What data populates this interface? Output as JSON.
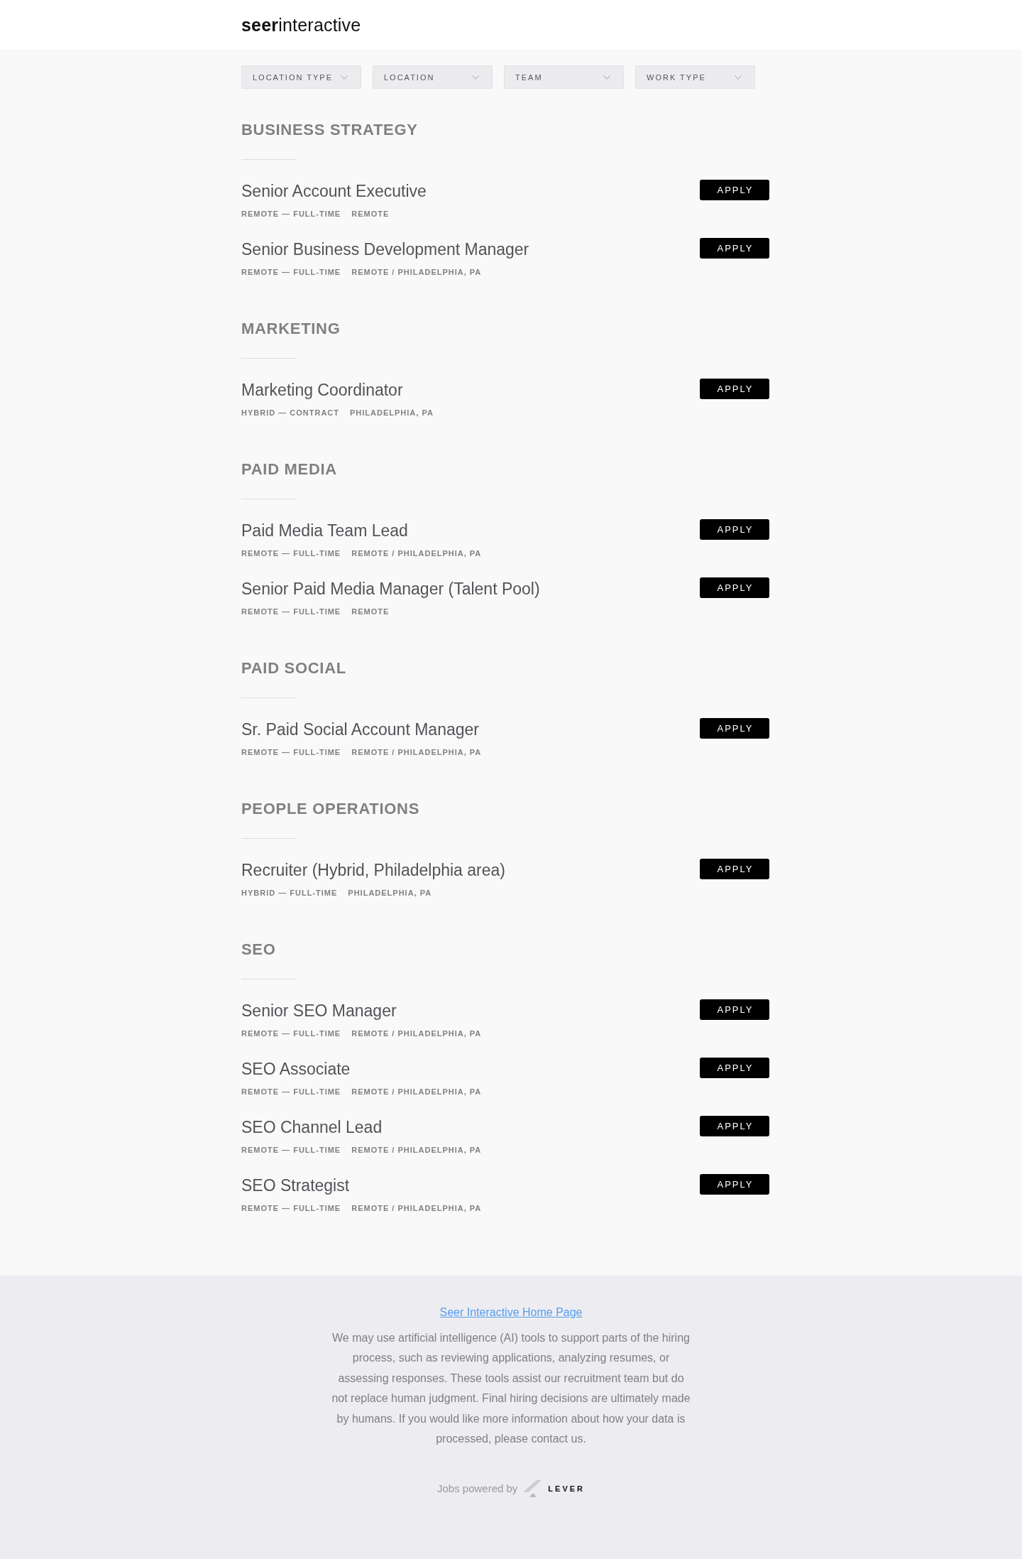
{
  "header": {
    "logo": "**seer**interactive"
  },
  "filters": [
    {
      "label": "LOCATION TYPE"
    },
    {
      "label": "LOCATION"
    },
    {
      "label": "TEAM"
    },
    {
      "label": "WORK TYPE"
    }
  ],
  "sections": [
    {
      "title": "BUSINESS STRATEGY",
      "postings": [
        {
          "title": "Senior Account Executive",
          "work_type": "REMOTE — FULL-TIME",
          "location": "REMOTE",
          "button": "APPLY"
        },
        {
          "title": "Senior Business Development Manager",
          "work_type": "REMOTE — FULL-TIME",
          "location": "REMOTE / PHILADELPHIA, PA",
          "button": "APPLY"
        }
      ]
    },
    {
      "title": "MARKETING",
      "postings": [
        {
          "title": "Marketing Coordinator",
          "work_type": "HYBRID — CONTRACT",
          "location": "PHILADELPHIA, PA",
          "button": "APPLY"
        }
      ]
    },
    {
      "title": "PAID MEDIA",
      "postings": [
        {
          "title": "Paid Media Team Lead",
          "work_type": "REMOTE — FULL-TIME",
          "location": "REMOTE / PHILADELPHIA, PA",
          "button": "APPLY"
        },
        {
          "title": "Senior Paid Media Manager (Talent Pool)",
          "work_type": "REMOTE — FULL-TIME",
          "location": "REMOTE",
          "button": "APPLY"
        }
      ]
    },
    {
      "title": "PAID SOCIAL",
      "postings": [
        {
          "title": "Sr. Paid Social Account Manager",
          "work_type": "REMOTE — FULL-TIME",
          "location": "REMOTE / PHILADELPHIA, PA",
          "button": "APPLY"
        }
      ]
    },
    {
      "title": "PEOPLE OPERATIONS",
      "postings": [
        {
          "title": "Recruiter (Hybrid, Philadelphia area)",
          "work_type": "HYBRID — FULL-TIME",
          "location": "PHILADELPHIA, PA",
          "button": "APPLY"
        }
      ]
    },
    {
      "title": "SEO",
      "postings": [
        {
          "title": "Senior SEO Manager",
          "work_type": "REMOTE — FULL-TIME",
          "location": "REMOTE / PHILADELPHIA, PA",
          "button": "APPLY"
        },
        {
          "title": "SEO Associate",
          "work_type": "REMOTE — FULL-TIME",
          "location": "REMOTE / PHILADELPHIA, PA",
          "button": "APPLY"
        },
        {
          "title": "SEO Channel Lead",
          "work_type": "REMOTE — FULL-TIME",
          "location": "REMOTE / PHILADELPHIA, PA",
          "button": "APPLY"
        },
        {
          "title": "SEO Strategist",
          "work_type": "REMOTE — FULL-TIME",
          "location": "REMOTE / PHILADELPHIA, PA",
          "button": "APPLY"
        }
      ]
    }
  ],
  "footer": {
    "link": "Seer Interactive Home Page",
    "notice": "We may use artificial intelligence (AI) tools to support parts of the hiring process, such as reviewing applications, analyzing resumes, or assessing responses. These tools assist our recruitment team but do not replace human judgment. Final hiring decisions are ultimately made by humans. If you would like more information about how your data is processed, please contact us.",
    "powered_by": "Jobs powered by",
    "brand": "LEVER"
  }
}
